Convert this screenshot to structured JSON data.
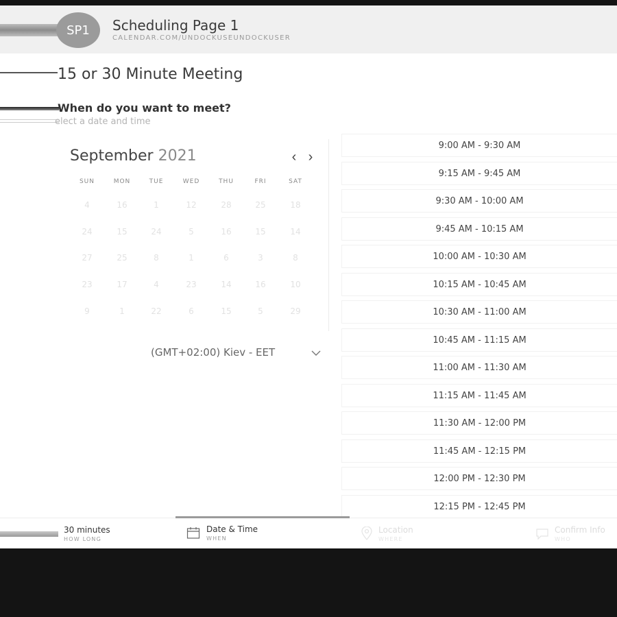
{
  "header": {
    "avatar_initials": "SP1",
    "title": "Scheduling Page 1",
    "url": "CALENDAR.COM/UNDOCKUSEUNDOCKUSER"
  },
  "event": {
    "title": "15 or 30 Minute Meeting",
    "question": "When do you want to meet?",
    "question_hint": "elect a date and time"
  },
  "calendar": {
    "month": "September",
    "year": "2021",
    "prev_icon": "chevron-left-icon",
    "next_icon": "chevron-right-icon",
    "weekdays": [
      "SUN",
      "MON",
      "TUE",
      "WED",
      "THU",
      "FRI",
      "SAT"
    ],
    "weeks": [
      [
        "4",
        "16",
        "1",
        "12",
        "28",
        "25",
        "18"
      ],
      [
        "24",
        "15",
        "24",
        "5",
        "16",
        "15",
        "14"
      ],
      [
        "27",
        "25",
        "8",
        "1",
        "6",
        "3",
        "8"
      ],
      [
        "23",
        "17",
        "4",
        "23",
        "14",
        "16",
        "10"
      ],
      [
        "9",
        "1",
        "22",
        "6",
        "15",
        "5",
        "29"
      ]
    ],
    "timezone": "(GMT+02:00) Kiev - EET"
  },
  "time_slots": [
    "9:00 AM - 9:30 AM",
    "9:15 AM - 9:45 AM",
    "9:30 AM - 10:00 AM",
    "9:45 AM - 10:15 AM",
    "10:00 AM - 10:30 AM",
    "10:15 AM - 10:45 AM",
    "10:30 AM - 11:00 AM",
    "10:45 AM - 11:15 AM",
    "11:00 AM - 11:30 AM",
    "11:15 AM - 11:45 AM",
    "11:30 AM - 12:00 PM",
    "11:45 AM - 12:15 PM",
    "12:00 PM - 12:30 PM",
    "12:15 PM - 12:45 PM"
  ],
  "steps": {
    "duration": {
      "title": "30 minutes",
      "sub": "HOW LONG"
    },
    "datetime": {
      "title": "Date & Time",
      "sub": "WHEN",
      "icon": "calendar-icon"
    },
    "location": {
      "title": "Location",
      "sub": "WHERE",
      "icon": "location-pin-icon"
    },
    "confirm": {
      "title": "Confirm Info",
      "sub": "WHO",
      "icon": "chat-bubble-icon"
    }
  }
}
